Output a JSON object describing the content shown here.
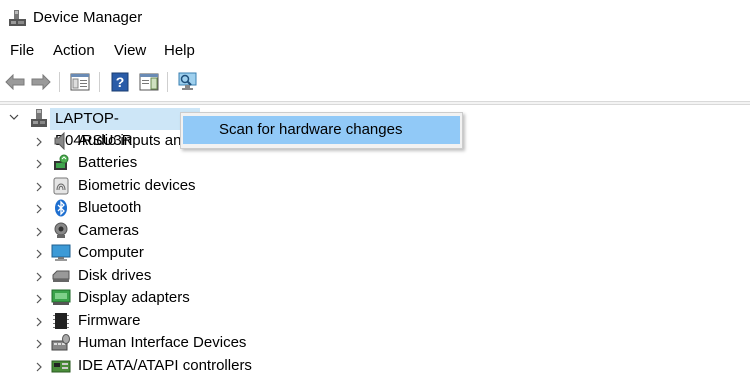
{
  "window": {
    "title": "Device Manager",
    "icon": "device-manager-icon"
  },
  "menubar": {
    "items": [
      "File",
      "Action",
      "View",
      "Help"
    ]
  },
  "toolbar": {
    "buttons": [
      "back-arrow-icon",
      "forward-arrow-icon",
      "properties-icon",
      "help-icon",
      "show-hide-pane-icon",
      "scan-hardware-icon"
    ]
  },
  "tree": {
    "root": {
      "label": "LAPTOP-B04RSU3R",
      "expanded": true,
      "icon": "computer-tower-icon"
    },
    "categories": [
      {
        "label": "Audio inputs and outputs",
        "icon": "speaker-icon"
      },
      {
        "label": "Batteries",
        "icon": "battery-icon"
      },
      {
        "label": "Biometric devices",
        "icon": "fingerprint-icon"
      },
      {
        "label": "Bluetooth",
        "icon": "bluetooth-icon"
      },
      {
        "label": "Cameras",
        "icon": "camera-icon"
      },
      {
        "label": "Computer",
        "icon": "monitor-icon"
      },
      {
        "label": "Disk drives",
        "icon": "disk-drive-icon"
      },
      {
        "label": "Display adapters",
        "icon": "display-adapter-icon"
      },
      {
        "label": "Firmware",
        "icon": "firmware-chip-icon"
      },
      {
        "label": "Human Interface Devices",
        "icon": "hid-icon"
      },
      {
        "label": "IDE ATA/ATAPI controllers",
        "icon": "ide-controller-icon"
      }
    ]
  },
  "context_menu": {
    "items": [
      {
        "label": "Scan for hardware changes",
        "highlighted": true
      }
    ]
  },
  "colors": {
    "selection": "#cde6f7",
    "menu_highlight": "#91c9f7",
    "menu_bg": "#f2f2f2"
  }
}
